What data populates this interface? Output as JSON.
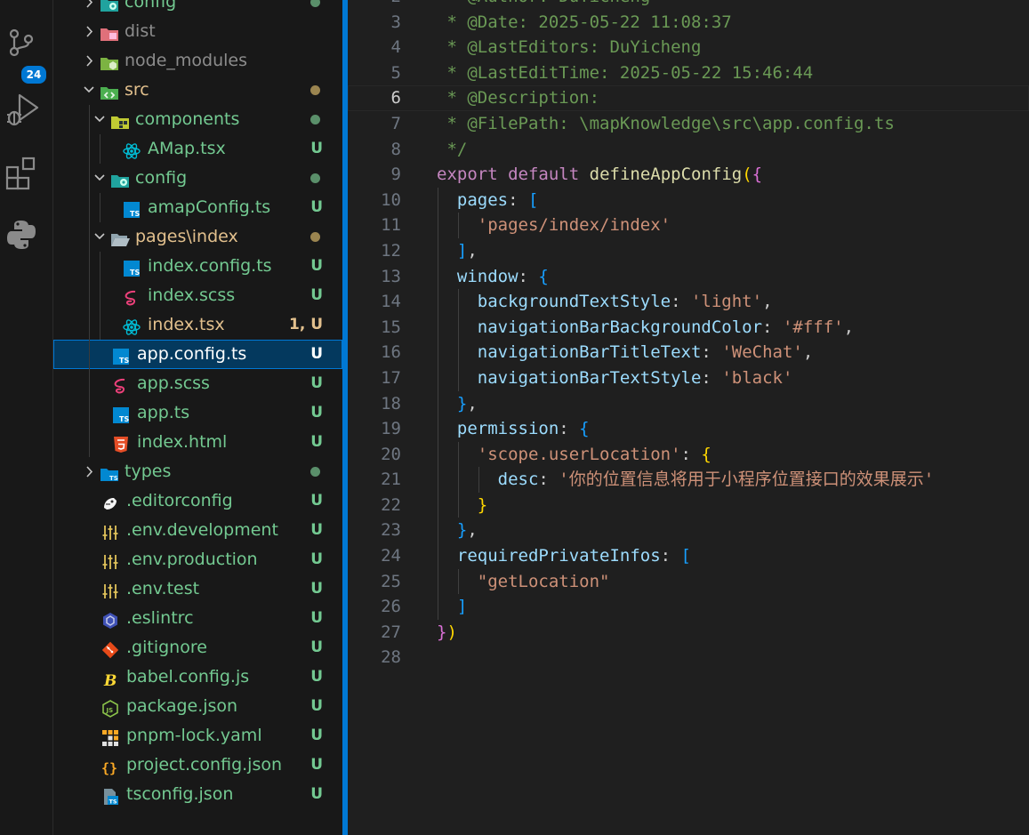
{
  "activity_bar": {
    "items": [
      {
        "name": "source-control",
        "icon": "source-control-icon",
        "badge": "24"
      },
      {
        "name": "run-debug",
        "icon": "run-debug-icon"
      },
      {
        "name": "extensions",
        "icon": "extensions-icon"
      },
      {
        "name": "python",
        "icon": "python-icon"
      }
    ]
  },
  "explorer": {
    "rows": [
      {
        "label": "config",
        "depth": 0,
        "chevron": ">",
        "icon": "folder-config-icon",
        "color": "c-green",
        "decoration": "dot",
        "dot_color": "#5a8f6a"
      },
      {
        "label": "dist",
        "depth": 0,
        "chevron": ">",
        "icon": "folder-dist-icon",
        "color": "c-gray",
        "decoration": ""
      },
      {
        "label": "node_modules",
        "depth": 0,
        "chevron": ">",
        "icon": "folder-node-icon",
        "color": "c-gray",
        "decoration": ""
      },
      {
        "label": "src",
        "depth": 0,
        "chevron": "v",
        "icon": "folder-src-icon",
        "color": "c-yellow",
        "decoration": "dot",
        "dot_color": "#9b8550"
      },
      {
        "label": "components",
        "depth": 1,
        "chevron": "v",
        "icon": "folder-components-icon",
        "color": "c-green",
        "decoration": "dot",
        "dot_color": "#5a8f6a"
      },
      {
        "label": "AMap.tsx",
        "depth": 2,
        "chevron": "",
        "icon": "react-icon",
        "color": "c-green",
        "decoration": "U"
      },
      {
        "label": "config",
        "depth": 1,
        "chevron": "v",
        "icon": "folder-config-icon",
        "color": "c-green",
        "decoration": "dot",
        "dot_color": "#5a8f6a"
      },
      {
        "label": "amapConfig.ts",
        "depth": 2,
        "chevron": "",
        "icon": "typescript-icon",
        "color": "c-green",
        "decoration": "U"
      },
      {
        "label": "pages\\index",
        "depth": 1,
        "chevron": "v",
        "icon": "folder-open-icon",
        "color": "c-yellow",
        "decoration": "dot",
        "dot_color": "#9b8550"
      },
      {
        "label": "index.config.ts",
        "depth": 2,
        "chevron": "",
        "icon": "typescript-icon",
        "color": "c-green",
        "decoration": "U"
      },
      {
        "label": "index.scss",
        "depth": 2,
        "chevron": "",
        "icon": "sass-icon",
        "color": "c-green",
        "decoration": "U"
      },
      {
        "label": "index.tsx",
        "depth": 2,
        "chevron": "",
        "icon": "react-icon",
        "color": "c-yellow",
        "decoration": "1, U",
        "decoration_color": "c-yellow"
      },
      {
        "label": "app.config.ts",
        "depth": 1,
        "chevron": "",
        "icon": "typescript-icon",
        "color": "c-white",
        "decoration": "U",
        "selected": true
      },
      {
        "label": "app.scss",
        "depth": 1,
        "chevron": "",
        "icon": "sass-icon",
        "color": "c-green",
        "decoration": "U"
      },
      {
        "label": "app.ts",
        "depth": 1,
        "chevron": "",
        "icon": "typescript-icon",
        "color": "c-green",
        "decoration": "U"
      },
      {
        "label": "index.html",
        "depth": 1,
        "chevron": "",
        "icon": "html-icon",
        "color": "c-green",
        "decoration": "U"
      },
      {
        "label": "types",
        "depth": 0,
        "chevron": ">",
        "icon": "folder-types-icon",
        "color": "c-green",
        "decoration": "dot",
        "dot_color": "#5a8f6a"
      },
      {
        "label": ".editorconfig",
        "depth": 0,
        "chevron": "",
        "icon": "editorconfig-icon",
        "color": "c-green",
        "decoration": "U"
      },
      {
        "label": ".env.development",
        "depth": 0,
        "chevron": "",
        "icon": "env-icon",
        "color": "c-green",
        "decoration": "U"
      },
      {
        "label": ".env.production",
        "depth": 0,
        "chevron": "",
        "icon": "env-icon",
        "color": "c-green",
        "decoration": "U"
      },
      {
        "label": ".env.test",
        "depth": 0,
        "chevron": "",
        "icon": "env-icon",
        "color": "c-green",
        "decoration": "U"
      },
      {
        "label": ".eslintrc",
        "depth": 0,
        "chevron": "",
        "icon": "eslint-icon",
        "color": "c-green",
        "decoration": "U"
      },
      {
        "label": ".gitignore",
        "depth": 0,
        "chevron": "",
        "icon": "git-icon",
        "color": "c-green",
        "decoration": "U"
      },
      {
        "label": "babel.config.js",
        "depth": 0,
        "chevron": "",
        "icon": "babel-icon",
        "color": "c-green",
        "decoration": "U"
      },
      {
        "label": "package.json",
        "depth": 0,
        "chevron": "",
        "icon": "nodejs-icon",
        "color": "c-green",
        "decoration": "U"
      },
      {
        "label": "pnpm-lock.yaml",
        "depth": 0,
        "chevron": "",
        "icon": "pnpm-icon",
        "color": "c-green",
        "decoration": "U"
      },
      {
        "label": "project.config.json",
        "depth": 0,
        "chevron": "",
        "icon": "json-icon",
        "color": "c-green",
        "decoration": "U"
      },
      {
        "label": "tsconfig.json",
        "depth": 0,
        "chevron": "",
        "icon": "tsconfig-icon",
        "color": "c-green",
        "decoration": "U"
      }
    ]
  },
  "editor": {
    "active_line": 6,
    "lines": [
      {
        "n": "2",
        "indent": 0,
        "tokens": [
          [
            " * @Author: DuYicheng",
            "t-cm"
          ]
        ]
      },
      {
        "n": "3",
        "indent": 0,
        "tokens": [
          [
            " * @Date: 2025-05-22 11:08:37",
            "t-cm"
          ]
        ]
      },
      {
        "n": "4",
        "indent": 0,
        "tokens": [
          [
            " * @LastEditors: DuYicheng",
            "t-cm"
          ]
        ]
      },
      {
        "n": "5",
        "indent": 0,
        "tokens": [
          [
            " * @LastEditTime: 2025-05-22 15:46:44",
            "t-cm"
          ]
        ]
      },
      {
        "n": "6",
        "indent": 0,
        "tokens": [
          [
            " * @Description: ",
            "t-cm"
          ]
        ]
      },
      {
        "n": "7",
        "indent": 0,
        "tokens": [
          [
            " * @FilePath: \\mapKnowledge\\src\\app.config.ts",
            "t-cm"
          ]
        ]
      },
      {
        "n": "8",
        "indent": 0,
        "tokens": [
          [
            " */",
            "t-cm"
          ]
        ]
      },
      {
        "n": "9",
        "indent": 0,
        "tokens": [
          [
            "export",
            "t-kw"
          ],
          [
            " ",
            "t-pu"
          ],
          [
            "default",
            "t-kw"
          ],
          [
            " ",
            "t-pu"
          ],
          [
            "defineAppConfig",
            "t-fn"
          ],
          [
            "(",
            "b1"
          ],
          [
            "{",
            "b2"
          ]
        ]
      },
      {
        "n": "10",
        "indent": 1,
        "tokens": [
          [
            "pages",
            "t-pr"
          ],
          [
            ": ",
            "t-pu"
          ],
          [
            "[",
            "b3"
          ]
        ]
      },
      {
        "n": "11",
        "indent": 2,
        "tokens": [
          [
            "'pages/index/index'",
            "t-st"
          ]
        ]
      },
      {
        "n": "12",
        "indent": 1,
        "tokens": [
          [
            "]",
            "b3"
          ],
          [
            ",",
            "t-pu"
          ]
        ]
      },
      {
        "n": "13",
        "indent": 1,
        "tokens": [
          [
            "window",
            "t-pr"
          ],
          [
            ": ",
            "t-pu"
          ],
          [
            "{",
            "b3"
          ]
        ]
      },
      {
        "n": "14",
        "indent": 2,
        "tokens": [
          [
            "backgroundTextStyle",
            "t-pr"
          ],
          [
            ": ",
            "t-pu"
          ],
          [
            "'light'",
            "t-st"
          ],
          [
            ",",
            "t-pu"
          ]
        ]
      },
      {
        "n": "15",
        "indent": 2,
        "tokens": [
          [
            "navigationBarBackgroundColor",
            "t-pr"
          ],
          [
            ": ",
            "t-pu"
          ],
          [
            "'#fff'",
            "t-st"
          ],
          [
            ",",
            "t-pu"
          ]
        ]
      },
      {
        "n": "16",
        "indent": 2,
        "tokens": [
          [
            "navigationBarTitleText",
            "t-pr"
          ],
          [
            ": ",
            "t-pu"
          ],
          [
            "'WeChat'",
            "t-st"
          ],
          [
            ",",
            "t-pu"
          ]
        ]
      },
      {
        "n": "17",
        "indent": 2,
        "tokens": [
          [
            "navigationBarTextStyle",
            "t-pr"
          ],
          [
            ": ",
            "t-pu"
          ],
          [
            "'black'",
            "t-st"
          ]
        ]
      },
      {
        "n": "18",
        "indent": 1,
        "tokens": [
          [
            "}",
            "b3"
          ],
          [
            ",",
            "t-pu"
          ]
        ]
      },
      {
        "n": "19",
        "indent": 1,
        "tokens": [
          [
            "permission",
            "t-pr"
          ],
          [
            ": ",
            "t-pu"
          ],
          [
            "{",
            "b3"
          ]
        ]
      },
      {
        "n": "20",
        "indent": 2,
        "tokens": [
          [
            "'scope.userLocation'",
            "t-st"
          ],
          [
            ": ",
            "t-pu"
          ],
          [
            "{",
            "b1"
          ]
        ]
      },
      {
        "n": "21",
        "indent": 3,
        "tokens": [
          [
            "desc",
            "t-pr"
          ],
          [
            ": ",
            "t-pu"
          ],
          [
            "'你的位置信息将用于小程序位置接口的效果展示'",
            "t-st"
          ]
        ]
      },
      {
        "n": "22",
        "indent": 2,
        "tokens": [
          [
            "}",
            "b1"
          ]
        ]
      },
      {
        "n": "23",
        "indent": 1,
        "tokens": [
          [
            "}",
            "b3"
          ],
          [
            ",",
            "t-pu"
          ]
        ]
      },
      {
        "n": "24",
        "indent": 1,
        "tokens": [
          [
            "requiredPrivateInfos",
            "t-pr"
          ],
          [
            ": ",
            "t-pu"
          ],
          [
            "[",
            "b3"
          ]
        ]
      },
      {
        "n": "25",
        "indent": 2,
        "tokens": [
          [
            "\"getLocation\"",
            "t-st"
          ]
        ]
      },
      {
        "n": "26",
        "indent": 1,
        "tokens": [
          [
            "]",
            "b3"
          ]
        ]
      },
      {
        "n": "27",
        "indent": 0,
        "tokens": [
          [
            "}",
            "b2"
          ],
          [
            ")",
            "b1"
          ]
        ]
      },
      {
        "n": "28",
        "indent": 0,
        "tokens": []
      }
    ]
  }
}
